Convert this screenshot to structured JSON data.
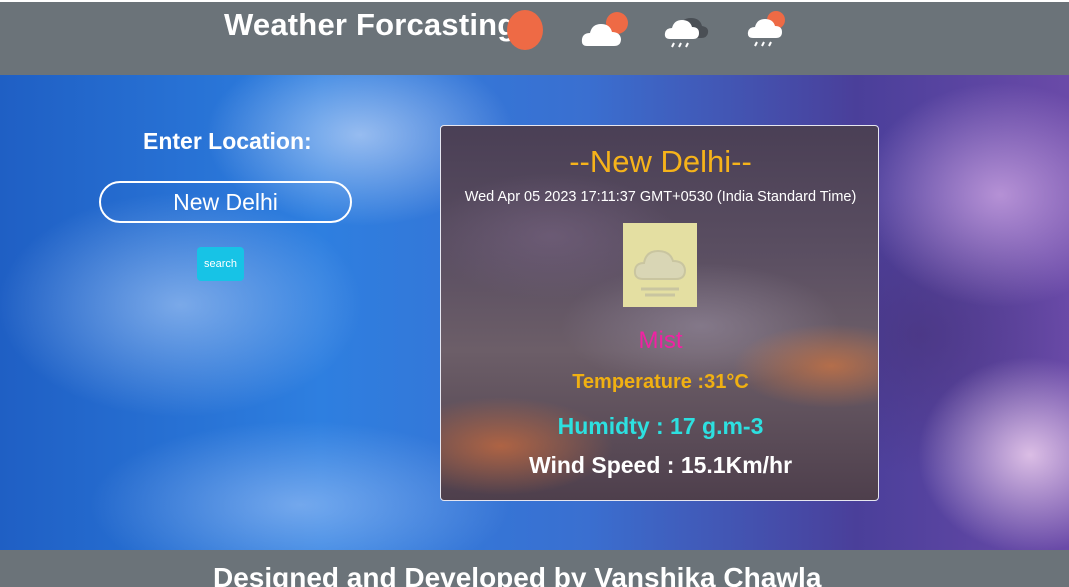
{
  "header": {
    "title": "Weather Forcasting",
    "icons": [
      "sun-icon",
      "partly-cloudy-icon",
      "thunder-rain-icon",
      "sun-rain-icon"
    ]
  },
  "search": {
    "label": "Enter Location:",
    "value": "New Delhi",
    "button_label": "search"
  },
  "weather": {
    "city": "--New Delhi--",
    "datetime": "Wed Apr 05 2023 17:11:37 GMT+0530 (India Standard Time)",
    "icon": "mist-cloud-icon",
    "condition": "Mist",
    "temperature": "Temperature :31°C",
    "humidity": "Humidty : 17 g.m-3",
    "wind": "Wind Speed : 15.1Km/hr"
  },
  "footer": {
    "text": "Designed and Developed by Vanshika Chawla"
  },
  "colors": {
    "bar": "#6b7379",
    "city": "#f6b31a",
    "condition": "#f022a3",
    "temperature": "#f0b012",
    "humidity": "#2de0e0",
    "button": "#17c3e6",
    "sun": "#ee6a45"
  }
}
